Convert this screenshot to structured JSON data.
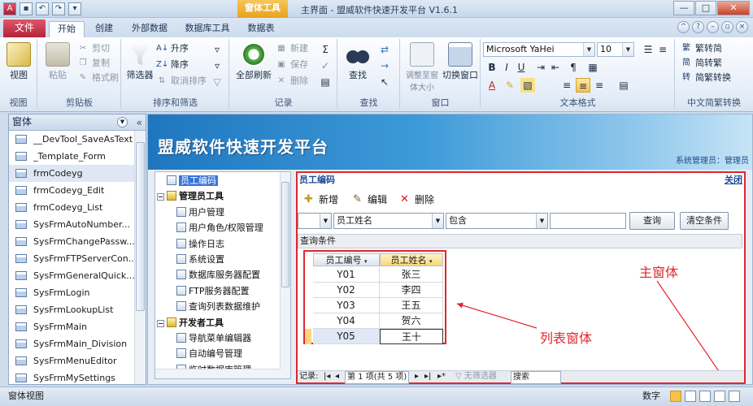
{
  "window": {
    "app_title": "主界面 - 盟威软件快速开发平台 V1.6.1",
    "context_tab": "窗体工具",
    "controls": [
      "—",
      "□",
      "✕"
    ]
  },
  "tabs": {
    "file": "文件",
    "items": [
      "开始",
      "创建",
      "外部数据",
      "数据库工具",
      "数据表"
    ],
    "active": "开始"
  },
  "ribbon": {
    "groups": {
      "view": {
        "label": "视图",
        "btn": "视图"
      },
      "clipboard": {
        "label": "剪贴板",
        "paste": "粘贴",
        "cut": "剪切",
        "copy": "复制",
        "format_painter": "格式刷"
      },
      "sort_filter": {
        "label": "排序和筛选",
        "filter": "筛选器",
        "asc": "升序",
        "desc": "降序",
        "clear_sort": "取消排序"
      },
      "records": {
        "label": "记录",
        "refresh_all": "全部刷新",
        "new": "新建",
        "save": "保存",
        "delete": "删除"
      },
      "find": {
        "label": "查找",
        "find": "查找"
      },
      "window": {
        "label": "窗口",
        "resize": "调整至窗体大小",
        "switch": "切换窗口"
      },
      "text_format": {
        "label": "文本格式",
        "font": "Microsoft YaHei",
        "size": "10"
      },
      "chinese": {
        "label": "中文简繁转换",
        "t2s": "繁转简",
        "s2t": "简转繁",
        "convert": "简繁转换"
      }
    }
  },
  "nav": {
    "title": "窗体",
    "items": [
      "__DevTool_SaveAsText",
      "_Template_Form",
      "frmCodeyg",
      "frmCodeyg_Edit",
      "frmCodeyg_List",
      "SysFrmAutoNumber...",
      "SysFrmChangePassw...",
      "SysFrmFTPServerCon...",
      "SysFrmGeneralQuick...",
      "SysFrmLogin",
      "SysFrmLookupList",
      "SysFrmMain",
      "SysFrmMain_Division",
      "SysFrmMenuEditor",
      "SysFrmMySettings"
    ]
  },
  "banner": {
    "title": "盟威软件快速开发平台",
    "user": "系统管理员：管理员"
  },
  "tree": {
    "nodes": [
      {
        "label": "员工编码",
        "level": 1,
        "selected": true
      },
      {
        "label": "管理员工具",
        "level": 0,
        "group": true
      },
      {
        "label": "用户管理",
        "level": 1
      },
      {
        "label": "用户角色/权限管理",
        "level": 1
      },
      {
        "label": "操作日志",
        "level": 1
      },
      {
        "label": "系统设置",
        "level": 1
      },
      {
        "label": "数据库服务器配置",
        "level": 1
      },
      {
        "label": "FTP服务器配置",
        "level": 1
      },
      {
        "label": "查询列表数据维护",
        "level": 1
      },
      {
        "label": "开发者工具",
        "level": 0,
        "group": true
      },
      {
        "label": "导航菜单编辑器",
        "level": 1
      },
      {
        "label": "自动编号管理",
        "level": 1
      },
      {
        "label": "临时数据库管理",
        "level": 1
      }
    ]
  },
  "form": {
    "title": "员工编码",
    "close": "关闭",
    "buttons": {
      "new": "新增",
      "edit": "编辑",
      "delete": "删除"
    },
    "filter": {
      "field": "员工姓名",
      "op": "包含",
      "value": "",
      "query": "查询",
      "clear": "清空条件"
    },
    "cond_label": "查询条件",
    "grid": {
      "headers": [
        "员工编号",
        "员工姓名"
      ],
      "rows": [
        [
          "Y01",
          "张三"
        ],
        [
          "Y02",
          "李四"
        ],
        [
          "Y03",
          "王五"
        ],
        [
          "Y04",
          "贺六"
        ],
        [
          "Y05",
          "王十"
        ]
      ]
    },
    "status": {
      "record_label": "记录:",
      "position": "第 1 项(共 5 项)",
      "no_filter": "无筛选器",
      "search": "搜索"
    }
  },
  "annotations": {
    "main": "主窗体",
    "list": "列表窗体"
  },
  "statusbar": {
    "left": "窗体视图",
    "right": "数字"
  }
}
